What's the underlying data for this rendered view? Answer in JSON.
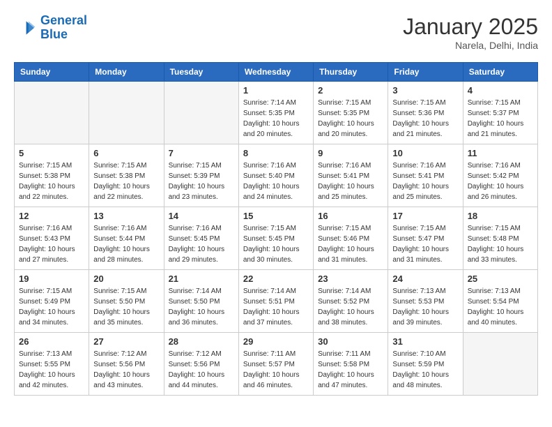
{
  "header": {
    "logo_line1": "General",
    "logo_line2": "Blue",
    "month": "January 2025",
    "location": "Narela, Delhi, India"
  },
  "weekdays": [
    "Sunday",
    "Monday",
    "Tuesday",
    "Wednesday",
    "Thursday",
    "Friday",
    "Saturday"
  ],
  "weeks": [
    [
      {
        "day": "",
        "info": ""
      },
      {
        "day": "",
        "info": ""
      },
      {
        "day": "",
        "info": ""
      },
      {
        "day": "1",
        "info": "Sunrise: 7:14 AM\nSunset: 5:35 PM\nDaylight: 10 hours\nand 20 minutes."
      },
      {
        "day": "2",
        "info": "Sunrise: 7:15 AM\nSunset: 5:35 PM\nDaylight: 10 hours\nand 20 minutes."
      },
      {
        "day": "3",
        "info": "Sunrise: 7:15 AM\nSunset: 5:36 PM\nDaylight: 10 hours\nand 21 minutes."
      },
      {
        "day": "4",
        "info": "Sunrise: 7:15 AM\nSunset: 5:37 PM\nDaylight: 10 hours\nand 21 minutes."
      }
    ],
    [
      {
        "day": "5",
        "info": "Sunrise: 7:15 AM\nSunset: 5:38 PM\nDaylight: 10 hours\nand 22 minutes."
      },
      {
        "day": "6",
        "info": "Sunrise: 7:15 AM\nSunset: 5:38 PM\nDaylight: 10 hours\nand 22 minutes."
      },
      {
        "day": "7",
        "info": "Sunrise: 7:15 AM\nSunset: 5:39 PM\nDaylight: 10 hours\nand 23 minutes."
      },
      {
        "day": "8",
        "info": "Sunrise: 7:16 AM\nSunset: 5:40 PM\nDaylight: 10 hours\nand 24 minutes."
      },
      {
        "day": "9",
        "info": "Sunrise: 7:16 AM\nSunset: 5:41 PM\nDaylight: 10 hours\nand 25 minutes."
      },
      {
        "day": "10",
        "info": "Sunrise: 7:16 AM\nSunset: 5:41 PM\nDaylight: 10 hours\nand 25 minutes."
      },
      {
        "day": "11",
        "info": "Sunrise: 7:16 AM\nSunset: 5:42 PM\nDaylight: 10 hours\nand 26 minutes."
      }
    ],
    [
      {
        "day": "12",
        "info": "Sunrise: 7:16 AM\nSunset: 5:43 PM\nDaylight: 10 hours\nand 27 minutes."
      },
      {
        "day": "13",
        "info": "Sunrise: 7:16 AM\nSunset: 5:44 PM\nDaylight: 10 hours\nand 28 minutes."
      },
      {
        "day": "14",
        "info": "Sunrise: 7:16 AM\nSunset: 5:45 PM\nDaylight: 10 hours\nand 29 minutes."
      },
      {
        "day": "15",
        "info": "Sunrise: 7:15 AM\nSunset: 5:45 PM\nDaylight: 10 hours\nand 30 minutes."
      },
      {
        "day": "16",
        "info": "Sunrise: 7:15 AM\nSunset: 5:46 PM\nDaylight: 10 hours\nand 31 minutes."
      },
      {
        "day": "17",
        "info": "Sunrise: 7:15 AM\nSunset: 5:47 PM\nDaylight: 10 hours\nand 31 minutes."
      },
      {
        "day": "18",
        "info": "Sunrise: 7:15 AM\nSunset: 5:48 PM\nDaylight: 10 hours\nand 33 minutes."
      }
    ],
    [
      {
        "day": "19",
        "info": "Sunrise: 7:15 AM\nSunset: 5:49 PM\nDaylight: 10 hours\nand 34 minutes."
      },
      {
        "day": "20",
        "info": "Sunrise: 7:15 AM\nSunset: 5:50 PM\nDaylight: 10 hours\nand 35 minutes."
      },
      {
        "day": "21",
        "info": "Sunrise: 7:14 AM\nSunset: 5:50 PM\nDaylight: 10 hours\nand 36 minutes."
      },
      {
        "day": "22",
        "info": "Sunrise: 7:14 AM\nSunset: 5:51 PM\nDaylight: 10 hours\nand 37 minutes."
      },
      {
        "day": "23",
        "info": "Sunrise: 7:14 AM\nSunset: 5:52 PM\nDaylight: 10 hours\nand 38 minutes."
      },
      {
        "day": "24",
        "info": "Sunrise: 7:13 AM\nSunset: 5:53 PM\nDaylight: 10 hours\nand 39 minutes."
      },
      {
        "day": "25",
        "info": "Sunrise: 7:13 AM\nSunset: 5:54 PM\nDaylight: 10 hours\nand 40 minutes."
      }
    ],
    [
      {
        "day": "26",
        "info": "Sunrise: 7:13 AM\nSunset: 5:55 PM\nDaylight: 10 hours\nand 42 minutes."
      },
      {
        "day": "27",
        "info": "Sunrise: 7:12 AM\nSunset: 5:56 PM\nDaylight: 10 hours\nand 43 minutes."
      },
      {
        "day": "28",
        "info": "Sunrise: 7:12 AM\nSunset: 5:56 PM\nDaylight: 10 hours\nand 44 minutes."
      },
      {
        "day": "29",
        "info": "Sunrise: 7:11 AM\nSunset: 5:57 PM\nDaylight: 10 hours\nand 46 minutes."
      },
      {
        "day": "30",
        "info": "Sunrise: 7:11 AM\nSunset: 5:58 PM\nDaylight: 10 hours\nand 47 minutes."
      },
      {
        "day": "31",
        "info": "Sunrise: 7:10 AM\nSunset: 5:59 PM\nDaylight: 10 hours\nand 48 minutes."
      },
      {
        "day": "",
        "info": ""
      }
    ]
  ]
}
